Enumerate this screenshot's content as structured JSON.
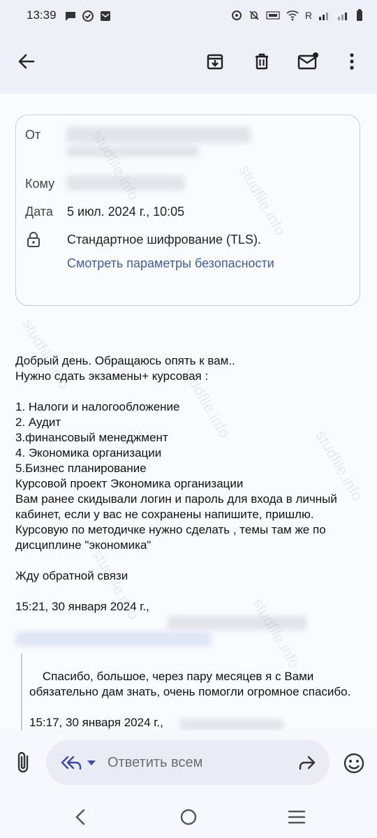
{
  "status_bar": {
    "time": "13:39",
    "carrier_label": "R"
  },
  "app_bar": {
    "back_label": "back",
    "icons": [
      "arrow-left-icon",
      "archive-icon",
      "delete-icon",
      "mark-unread-icon",
      "more-vert-icon"
    ]
  },
  "email_meta": {
    "from_label": "От",
    "to_label": "Кому",
    "date_label": "Дата",
    "date_value": "5 июл. 2024 г., 10:05",
    "encryption_text": "Стандартное шифрование (TLS).",
    "security_link": "Смотреть параметры безопасности"
  },
  "email_body": {
    "text": "Добрый день. Обращаюсь опять к вам..\nНужно сдать экзамены+ курсовая :\n\n1. Налоги и налогообложение\n2. Аудит\n3.финансовый менеджмент\n4. Экономика организации\n5.Бизнес планирование\nКурсовой проект Экономика организации\nВам ранее скидывали логин и пароль для входа в личный кабинет, если у вас не сохранены напишите, пришлю.\nКурсовую по методичке нужно сделать , темы там же по дисциплине \"экономика\"\n\nЖду обратной связи\n\n15:21, 30 января 2024 г.,",
    "quoted_text": "Спасибо, большое, через пару месяцев я с Вами обязательно дам знать, очень помогли огромное спасибо.\n\n15:17, 30 января 2024 г.,"
  },
  "composer": {
    "placeholder": "Ответить всем"
  },
  "watermark": "studfile.info"
}
